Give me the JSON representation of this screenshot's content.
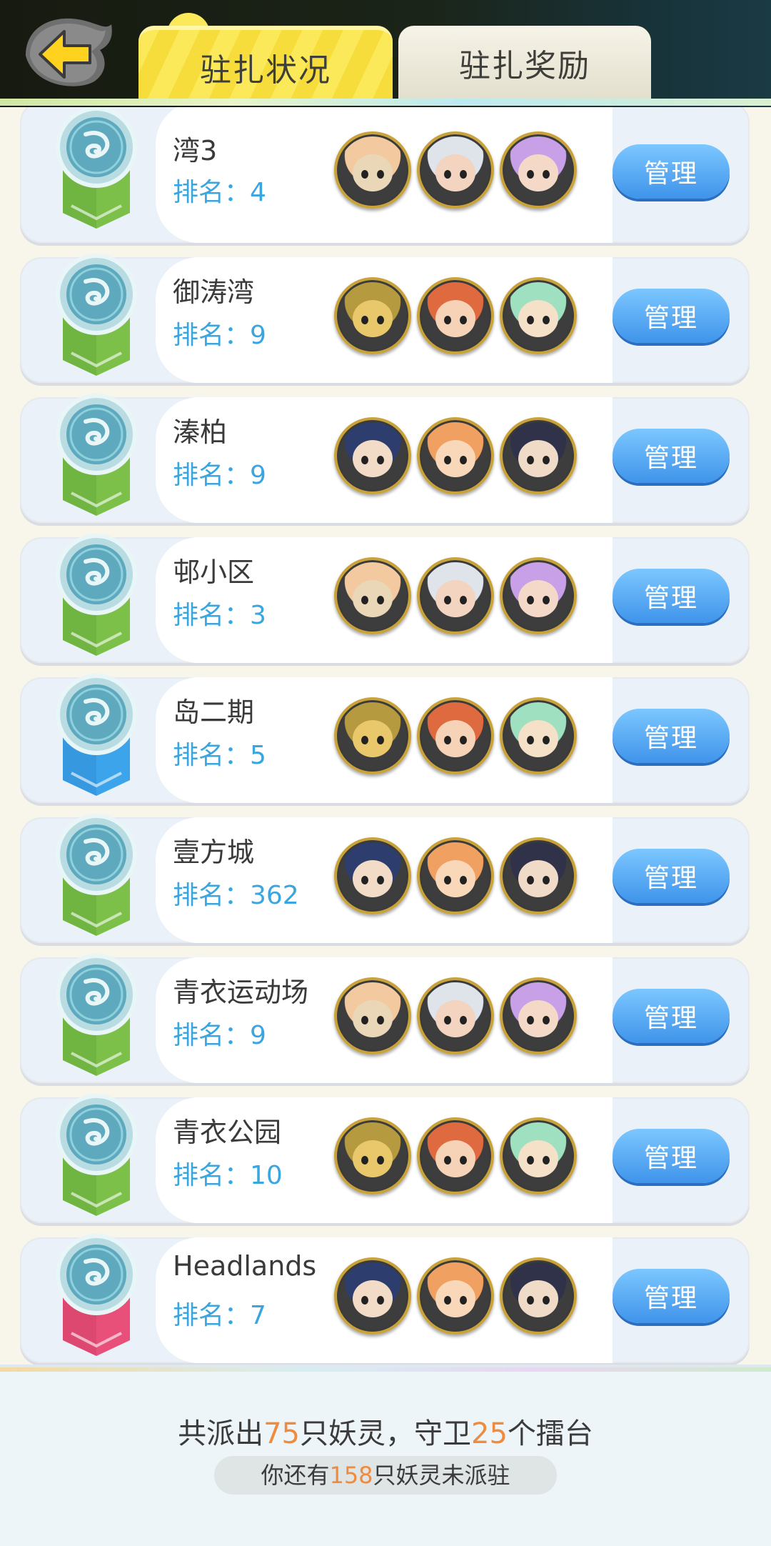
{
  "header": {
    "tabs": [
      {
        "label": "驻扎状况",
        "active": true
      },
      {
        "label": "驻扎奖励",
        "active": false
      }
    ],
    "back_icon": "back-arrow-icon"
  },
  "colors": {
    "rank_text": "#3aa5df",
    "manage_button": "#4a9ff0",
    "highlight_number": "#f08a3c",
    "medal_ribbon_green": "#7cc04a",
    "medal_ribbon_blue": "#3ca4ea",
    "medal_ribbon_pink": "#e8507a"
  },
  "rank_prefix": "排名：",
  "manage_label": "管理",
  "stations": [
    {
      "name": "湾3",
      "rank": "4",
      "ribbon": "green",
      "avatars": [
        "fox-demon-avatar",
        "white-fox-avatar",
        "purple-girl-avatar"
      ]
    },
    {
      "name": "御涛湾",
      "rank": "9",
      "ribbon": "green",
      "avatars": [
        "golden-dragon-avatar",
        "fox-girl-avatar",
        "green-girl-avatar"
      ]
    },
    {
      "name": "溱柏",
      "rank": "9",
      "ribbon": "green",
      "avatars": [
        "blue-hair-lady-avatar",
        "cat-boy-avatar",
        "dark-hair-girl-avatar"
      ]
    },
    {
      "name": "邨小区",
      "rank": "3",
      "ribbon": "green",
      "avatars": [
        "purple-lady-avatar",
        "red-dragon-avatar",
        "golden-warrior-avatar"
      ]
    },
    {
      "name": "岛二期",
      "rank": "5",
      "ribbon": "blue",
      "avatars": [
        "white-hair-girl-avatar",
        "crow-ninja-avatar",
        "teal-hair-girl-avatar"
      ]
    },
    {
      "name": "壹方城",
      "rank": "362",
      "ribbon": "green",
      "avatars": [
        "pink-fox-avatar",
        "golden-lion-avatar",
        "egg-creature-avatar"
      ]
    },
    {
      "name": "青衣运动场",
      "rank": "9",
      "ribbon": "green",
      "avatars": [
        "purple-ghost-avatar",
        "black-bear-avatar",
        "bull-warrior-avatar"
      ]
    },
    {
      "name": "青衣公园",
      "rank": "10",
      "ribbon": "green",
      "avatars": [
        "monk-avatar",
        "fox-demon-avatar",
        "cat-boy-avatar"
      ]
    },
    {
      "name": "Headlands",
      "rank": "7",
      "ribbon": "pink",
      "avatars": [
        "flower-girl-avatar",
        "ox-demon-avatar",
        "green-hat-avatar"
      ]
    }
  ],
  "footer": {
    "summary_pre": "共派出",
    "dispatched": "75",
    "summary_mid": "只妖灵，守卫",
    "arenas": "25",
    "summary_post": "个擂台",
    "remaining_pre": "你还有",
    "remaining": "158",
    "remaining_post": "只妖灵未派驻"
  }
}
